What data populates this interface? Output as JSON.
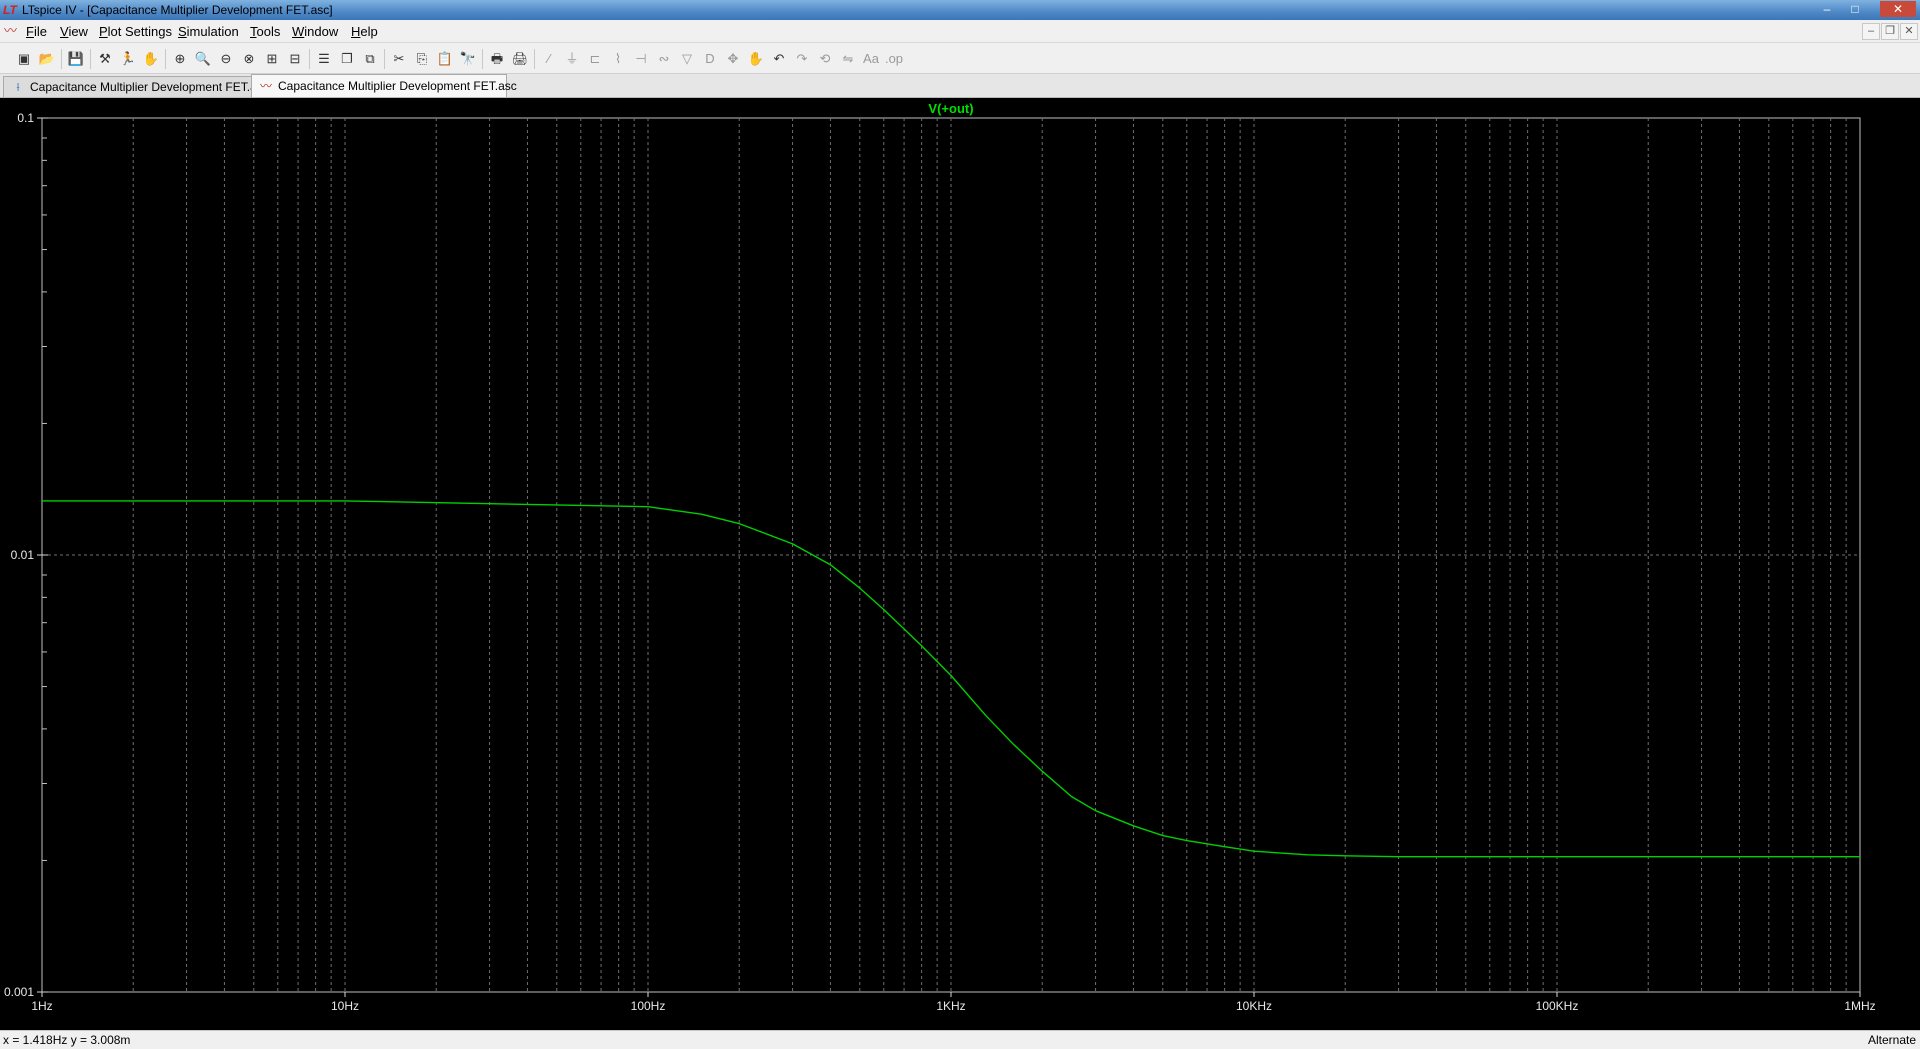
{
  "window": {
    "title": "LTspice IV - [Capacitance Multiplier Development FET.asc]",
    "app_icon": "ltspice-logo-icon",
    "controls": {
      "minimize": "–",
      "maximize": "□",
      "close": "✕"
    }
  },
  "menubar": {
    "items": [
      {
        "label": "File",
        "u": "F",
        "rest": "ile"
      },
      {
        "label": "View",
        "u": "V",
        "rest": "iew"
      },
      {
        "label": "Plot Settings",
        "u": "P",
        "rest": "lot Settings"
      },
      {
        "label": "Simulation",
        "u": "S",
        "rest": "imulation"
      },
      {
        "label": "Tools",
        "u": "T",
        "rest": "ools"
      },
      {
        "label": "Window",
        "u": "W",
        "rest": "indow"
      },
      {
        "label": "Help",
        "u": "H",
        "rest": "elp"
      }
    ],
    "mdi_controls": {
      "minimize": "–",
      "restore": "❐",
      "close": "✕"
    }
  },
  "toolbar": {
    "buttons": [
      {
        "icon": "new-schematic-icon",
        "glyph": "▣",
        "enabled": true
      },
      {
        "icon": "open-icon",
        "glyph": "📂",
        "enabled": true
      },
      {
        "icon": "save-icon",
        "glyph": "💾",
        "enabled": true
      },
      {
        "icon": "control-panel-icon",
        "glyph": "⚒",
        "enabled": true
      },
      {
        "icon": "run-icon",
        "glyph": "🏃",
        "enabled": true
      },
      {
        "icon": "halt-icon",
        "glyph": "✋",
        "enabled": false
      },
      {
        "icon": "zoom-in-icon",
        "glyph": "⊕",
        "enabled": true
      },
      {
        "icon": "zoom-pan-icon",
        "glyph": "🔍",
        "enabled": true
      },
      {
        "icon": "zoom-out-icon",
        "glyph": "⊖",
        "enabled": true
      },
      {
        "icon": "zoom-fit-icon",
        "glyph": "⊗",
        "enabled": true
      },
      {
        "icon": "autorange-icon",
        "glyph": "⊞",
        "enabled": true
      },
      {
        "icon": "pick-visible-traces-icon",
        "glyph": "⊟",
        "enabled": true
      },
      {
        "icon": "tile-horizontal-icon",
        "glyph": "☰",
        "enabled": true
      },
      {
        "icon": "cascade-icon",
        "glyph": "❐",
        "enabled": true
      },
      {
        "icon": "tile-vertical-icon",
        "glyph": "⧉",
        "enabled": true
      },
      {
        "icon": "cut-icon",
        "glyph": "✂",
        "enabled": true
      },
      {
        "icon": "copy-icon",
        "glyph": "⎘",
        "enabled": true
      },
      {
        "icon": "paste-icon",
        "glyph": "📋",
        "enabled": true
      },
      {
        "icon": "find-icon",
        "glyph": "🔭",
        "enabled": true
      },
      {
        "icon": "print-setup-icon",
        "glyph": "🖶",
        "enabled": true
      },
      {
        "icon": "print-icon",
        "glyph": "🖨",
        "enabled": true
      },
      {
        "icon": "wire-icon",
        "glyph": "∕",
        "enabled": false
      },
      {
        "icon": "ground-icon",
        "glyph": "⏚",
        "enabled": false
      },
      {
        "icon": "label-net-icon",
        "glyph": "⊏",
        "enabled": false
      },
      {
        "icon": "resistor-icon",
        "glyph": "⌇",
        "enabled": false
      },
      {
        "icon": "capacitor-icon",
        "glyph": "⊣",
        "enabled": false
      },
      {
        "icon": "inductor-icon",
        "glyph": "∾",
        "enabled": false
      },
      {
        "icon": "diode-icon",
        "glyph": "▽",
        "enabled": false
      },
      {
        "icon": "component-icon",
        "glyph": "D",
        "enabled": false
      },
      {
        "icon": "move-icon",
        "glyph": "✥",
        "enabled": false
      },
      {
        "icon": "drag-icon",
        "glyph": "✋",
        "enabled": false
      },
      {
        "icon": "undo-icon",
        "glyph": "↶",
        "enabled": true
      },
      {
        "icon": "redo-icon",
        "glyph": "↷",
        "enabled": false
      },
      {
        "icon": "rotate-icon",
        "glyph": "⟲",
        "enabled": false
      },
      {
        "icon": "mirror-icon",
        "glyph": "⇋",
        "enabled": false
      },
      {
        "icon": "text-icon",
        "glyph": "Aa",
        "enabled": false
      },
      {
        "icon": "spice-directive-icon",
        "glyph": ".op",
        "enabled": false
      }
    ]
  },
  "tabs": [
    {
      "label": "Capacitance Multiplier Development FET.asc",
      "icon": "schematic-tab-icon",
      "glyph": "⟊",
      "active": false
    },
    {
      "label": "Capacitance Multiplier Development FET.asc",
      "icon": "waveform-tab-icon",
      "glyph": "〰",
      "active": true
    }
  ],
  "colors": {
    "trace": "#00d000",
    "trace_label": "#00e000",
    "grid": "#707070",
    "axis_text": "#e8e8e8",
    "background": "#000000"
  },
  "chart_data": {
    "type": "line",
    "title": "V(+out)",
    "x_scale": "log",
    "y_scale": "log",
    "xlim": [
      1,
      1000000
    ],
    "ylim": [
      0.001,
      0.1
    ],
    "x_ticks": [
      1,
      10,
      100,
      1000,
      10000,
      100000,
      1000000
    ],
    "x_tick_labels": [
      "1Hz",
      "10Hz",
      "100Hz",
      "1KHz",
      "10KHz",
      "100KHz",
      "1MHz"
    ],
    "y_ticks": [
      0.001,
      0.01,
      0.1
    ],
    "y_tick_labels": [
      "0.001",
      "0.01",
      "0.1"
    ],
    "grid": true,
    "series": [
      {
        "name": "V(+out)",
        "x": [
          1,
          10,
          100,
          150,
          200,
          300,
          400,
          500,
          600,
          800,
          1000,
          1300,
          1600,
          2000,
          2500,
          3000,
          4000,
          5000,
          6000,
          8000,
          10000,
          15000,
          20000,
          30000,
          100000,
          1000000
        ],
        "y": [
          0.0133,
          0.0133,
          0.0129,
          0.0124,
          0.0118,
          0.0106,
          0.0095,
          0.0084,
          0.0075,
          0.0062,
          0.0053,
          0.0043,
          0.0037,
          0.0032,
          0.0028,
          0.0026,
          0.0024,
          0.00228,
          0.00222,
          0.00215,
          0.0021,
          0.00206,
          0.00205,
          0.00204,
          0.00204,
          0.00204
        ]
      }
    ]
  },
  "status": {
    "coords": "x = 1.418Hz    y = 3.008m",
    "mode": "Alternate"
  }
}
